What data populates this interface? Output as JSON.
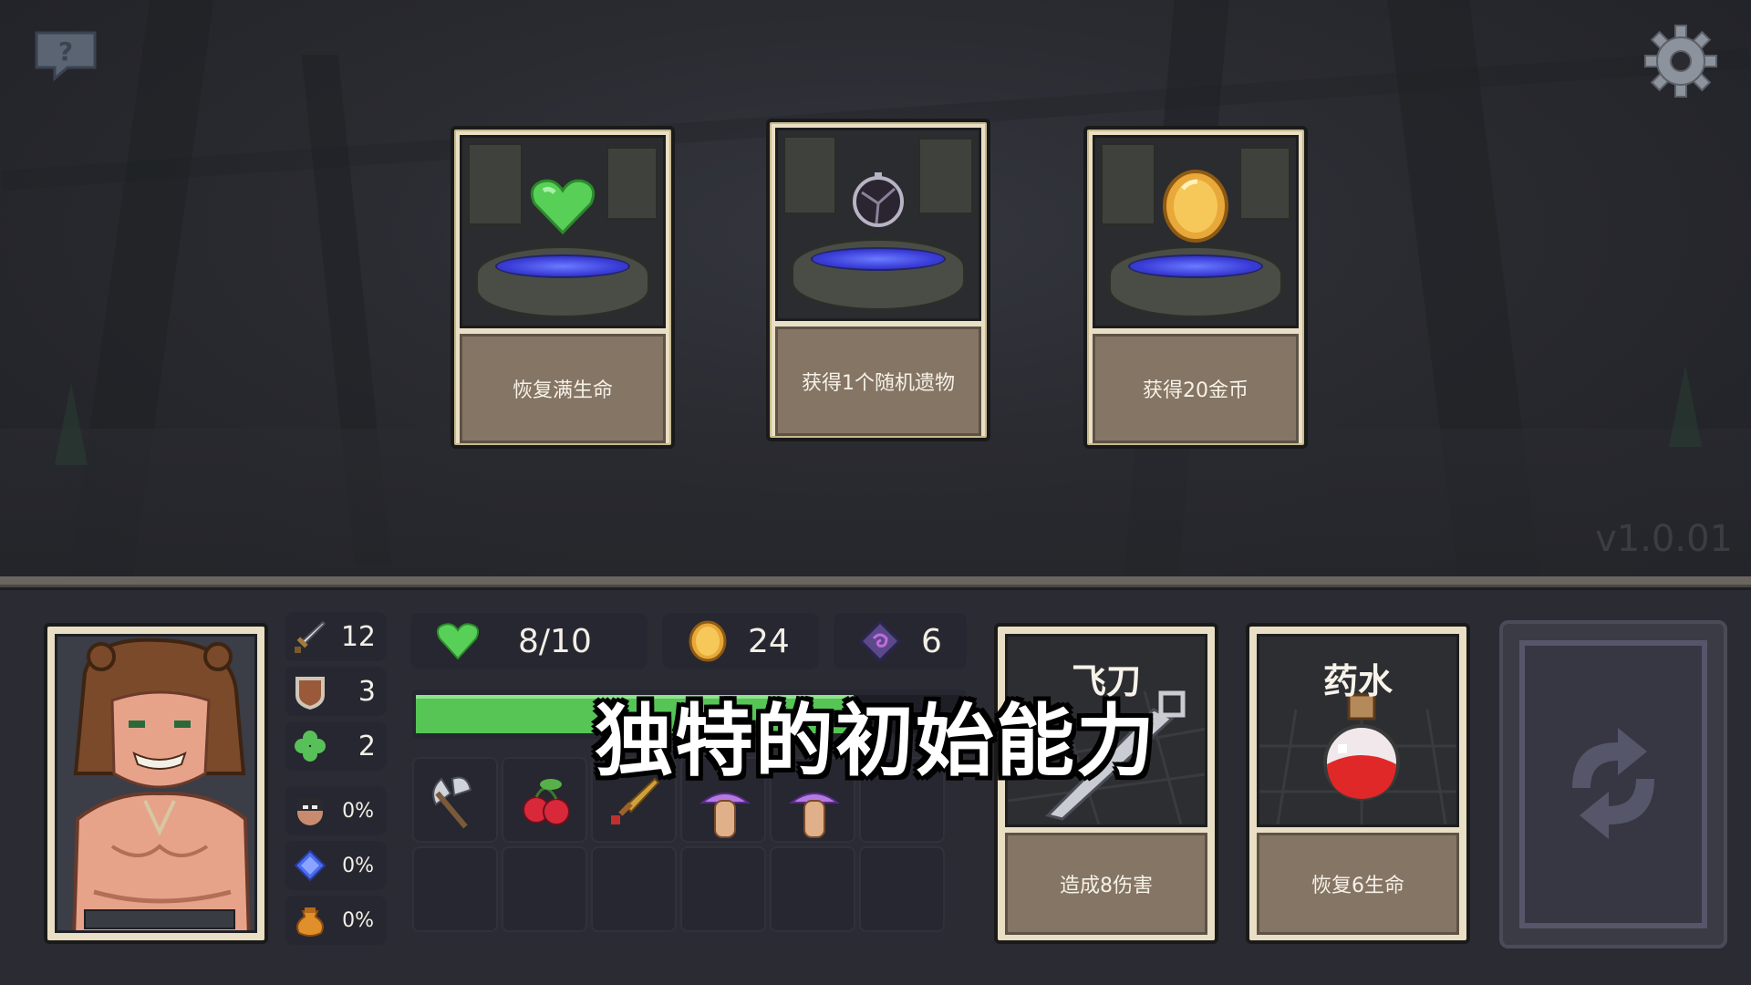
{
  "top": {
    "help_icon": "help-chat-icon",
    "settings_icon": "gear-icon",
    "version": "v1.0.01"
  },
  "events": [
    {
      "item_icon": "green-heart-icon",
      "label": "恢复满生命"
    },
    {
      "item_icon": "dark-relic-orb-icon",
      "label": "获得1个随机遗物"
    },
    {
      "item_icon": "gold-coin-icon",
      "label": "获得20金币"
    }
  ],
  "hero": {
    "portrait": "bear-hood-barbarian-portrait",
    "stats": [
      {
        "icon": "sword-icon",
        "value": "12"
      },
      {
        "icon": "shield-icon",
        "value": "3"
      },
      {
        "icon": "clover-icon",
        "value": "2"
      }
    ],
    "percents": [
      {
        "icon": "thief-head-icon",
        "value": "0%"
      },
      {
        "icon": "blue-crystal-icon",
        "value": "0%"
      },
      {
        "icon": "gold-pouch-icon",
        "value": "0%"
      }
    ]
  },
  "resources": {
    "hp": {
      "icon": "green-heart-icon",
      "value": "8/10",
      "fraction": 0.8
    },
    "gold": {
      "icon": "gold-coin-icon",
      "value": "24"
    },
    "gems": {
      "icon": "purple-rune-icon",
      "value": "6"
    }
  },
  "inventory": [
    "battle-axe-icon",
    "cherries-icon",
    "dagger-icon",
    "purple-mushroom-icon",
    "purple-mushroom-icon",
    "",
    "",
    "",
    "",
    "",
    "",
    ""
  ],
  "action_cards": [
    {
      "title": "飞刀",
      "desc": "造成8伤害",
      "art": "throwing-knife-art"
    },
    {
      "title": "药水",
      "desc": "恢复6生命",
      "art": "red-potion-art"
    }
  ],
  "deck_icon": "cycle-arrows-icon",
  "subtitle": "独特的初始能力",
  "colors": {
    "hp_green": "#56c556",
    "card_frame": "#e9dfc4",
    "card_desc_bg": "#857565",
    "panel_bg": "#2b2c33"
  }
}
